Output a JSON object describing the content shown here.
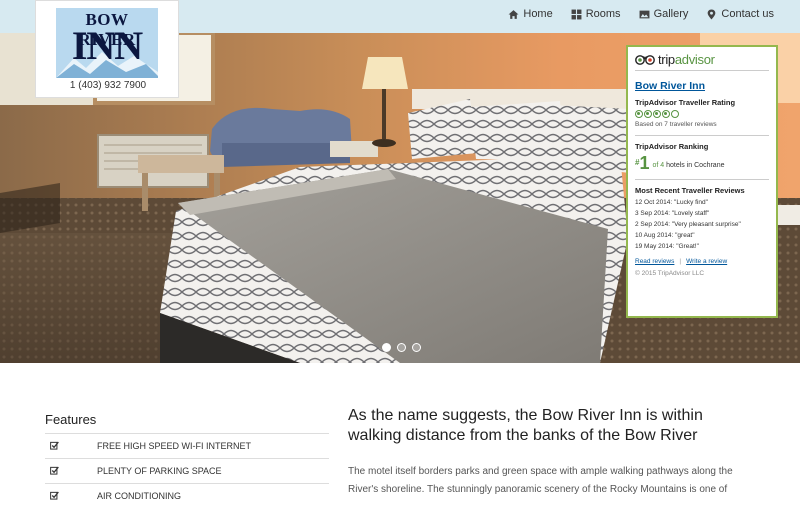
{
  "nav": {
    "items": [
      {
        "label": "Home",
        "icon": "home-icon"
      },
      {
        "label": "Rooms",
        "icon": "grid-icon"
      },
      {
        "label": "Gallery",
        "icon": "picture-icon"
      },
      {
        "label": "Contact us",
        "icon": "map-marker-icon"
      }
    ]
  },
  "logo": {
    "line1": "BOW RIVER",
    "line2": "INN",
    "phone": "1 (403) 932 7900"
  },
  "hero": {
    "slides_total": 3,
    "active_slide": 1
  },
  "tripadvisor": {
    "brand_prefix": "trip",
    "brand_suffix": "advisor",
    "hotel_name": "Bow River Inn",
    "rating_heading": "TripAdvisor Traveller Rating",
    "bubbles_filled": 4,
    "bubbles_total": 5,
    "based_on": "Based on 7 traveller reviews",
    "ranking_heading": "TripAdvisor Ranking",
    "rank_hash": "#",
    "rank_number": "1",
    "rank_of": "of 4",
    "rank_suffix": "hotels in Cochrane",
    "recent_heading": "Most Recent Traveller Reviews",
    "reviews": [
      "12 Oct 2014: \"Lucky find\"",
      "3 Sep 2014: \"Lovely staff\"",
      "2 Sep 2014: \"Very pleasant surprise\"",
      "10 Aug 2014: \"great\"",
      "19 May 2014: \"Great!\""
    ],
    "read_reviews": "Read reviews",
    "write_review": "Write a review",
    "copyright": "© 2015 TripAdvisor LLC"
  },
  "features": {
    "title": "Features",
    "items": [
      "FREE HIGH SPEED WI-FI INTERNET",
      "PLENTY OF PARKING SPACE",
      "AIR CONDITIONING"
    ]
  },
  "about": {
    "heading": "As the name suggests, the Bow River Inn is within walking distance from the banks of the Bow River",
    "paragraph": "The motel itself borders parks and green space with ample walking pathways along the River's shoreline. The stunningly panoramic scenery of the Rocky Mountains is one of"
  },
  "colors": {
    "topbar": "#d7eaf1",
    "ta_green": "#589442",
    "ta_link": "#00569a"
  }
}
